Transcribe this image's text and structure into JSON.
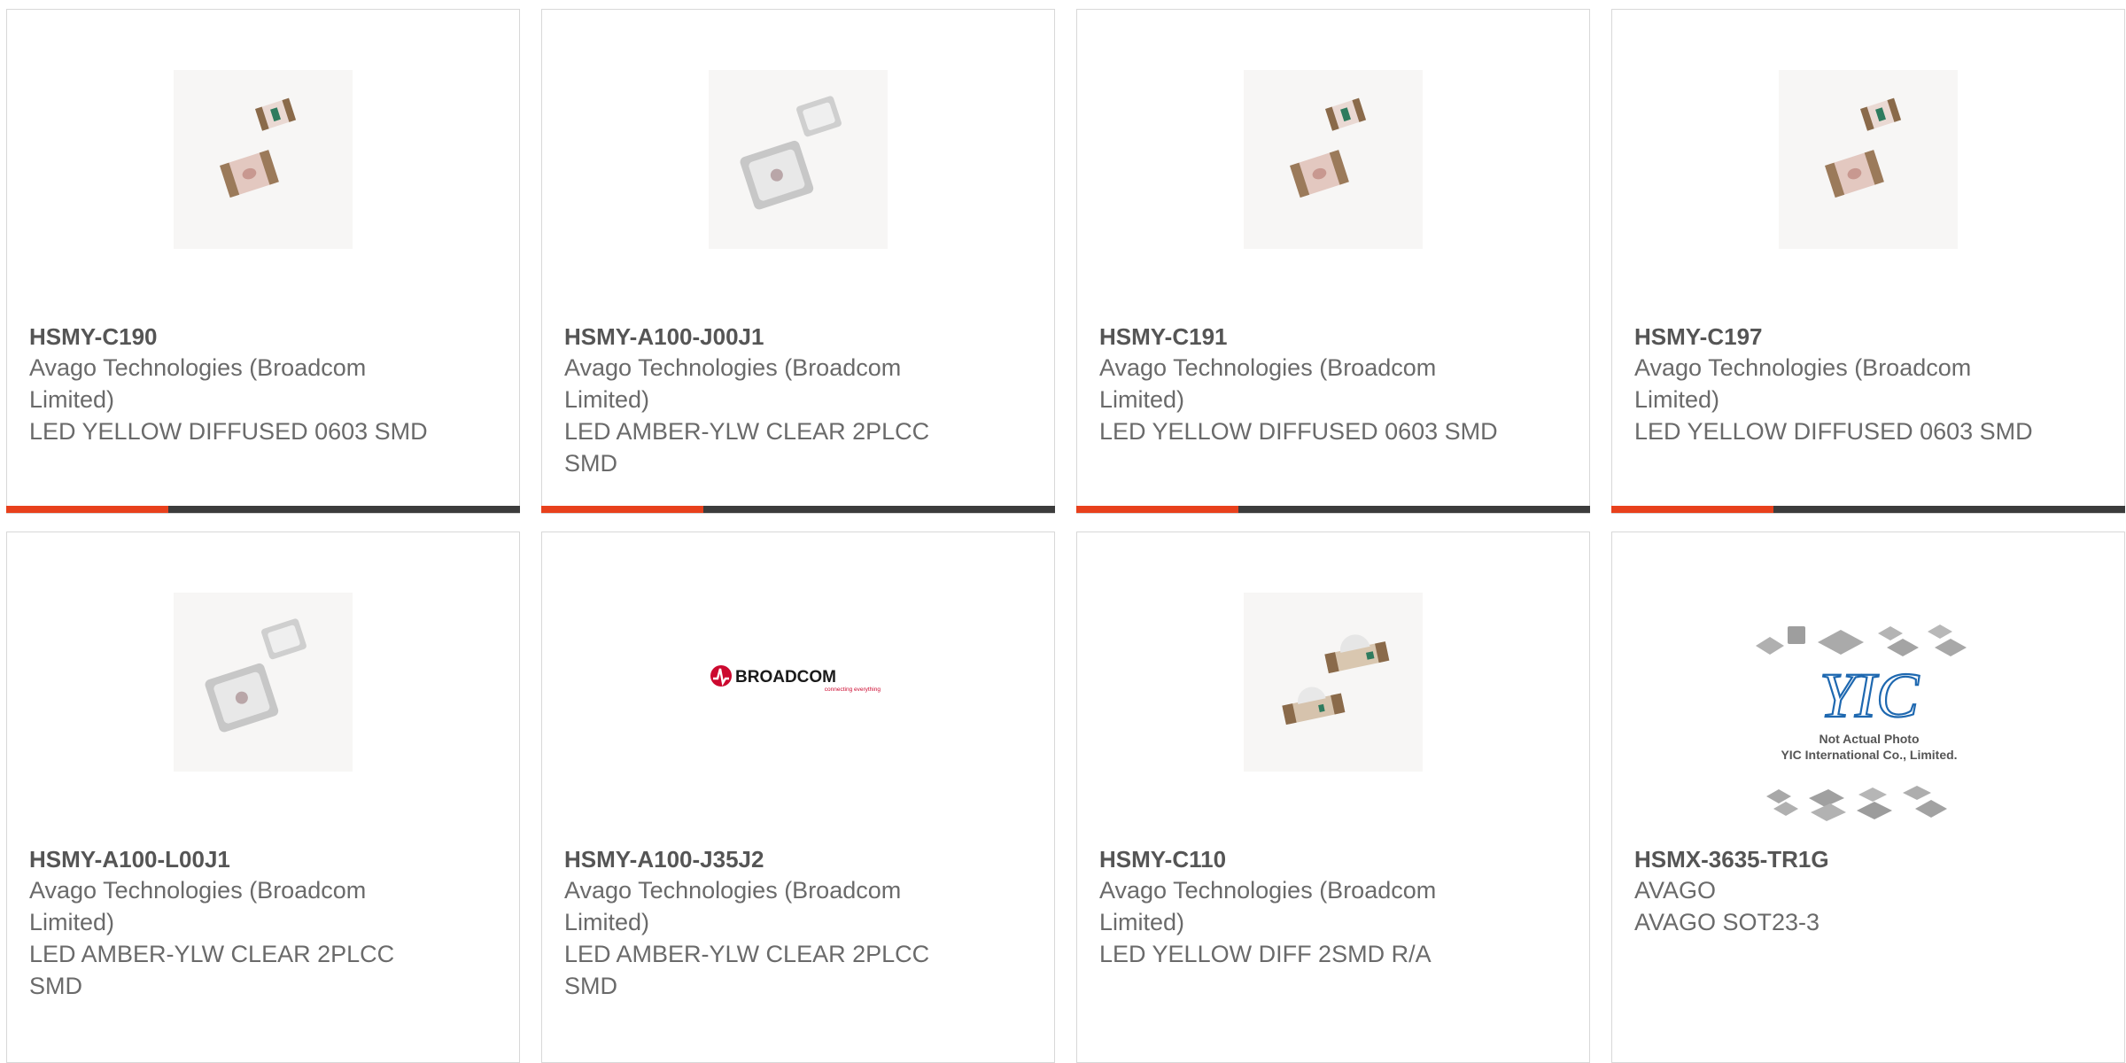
{
  "colors": {
    "accent": "#e8401c",
    "bar": "#3c3c3c",
    "border": "#d8d8d8",
    "broadcom_red": "#cc092f"
  },
  "products": [
    {
      "part_number": "HSMY-C190",
      "manufacturer": "Avago Technologies (Broadcom Limited)",
      "description": "LED YELLOW DIFFUSED 0603 SMD",
      "image": "led-0603-image"
    },
    {
      "part_number": "HSMY-A100-J00J1",
      "manufacturer": "Avago Technologies (Broadcom Limited)",
      "description": "LED AMBER-YLW CLEAR 2PLCC SMD",
      "image": "led-2plcc-image"
    },
    {
      "part_number": "HSMY-C191",
      "manufacturer": "Avago Technologies (Broadcom Limited)",
      "description": "LED YELLOW DIFFUSED 0603 SMD",
      "image": "led-0603-image"
    },
    {
      "part_number": "HSMY-C197",
      "manufacturer": "Avago Technologies (Broadcom Limited)",
      "description": "LED YELLOW DIFFUSED 0603 SMD",
      "image": "led-0603-image"
    },
    {
      "part_number": "HSMY-A100-L00J1",
      "manufacturer": "Avago Technologies (Broadcom Limited)",
      "description": "LED AMBER-YLW CLEAR 2PLCC SMD",
      "image": "led-2plcc-image"
    },
    {
      "part_number": "HSMY-A100-J35J2",
      "manufacturer": "Avago Technologies (Broadcom Limited)",
      "description": "LED AMBER-YLW CLEAR 2PLCC SMD",
      "image": "broadcom-logo"
    },
    {
      "part_number": "HSMY-C110",
      "manufacturer": "Avago Technologies (Broadcom Limited)",
      "description": "LED YELLOW DIFF 2SMD R/A",
      "image": "led-right-angle-image"
    },
    {
      "part_number": "HSMX-3635-TR1G",
      "manufacturer": "AVAGO",
      "description": "AVAGO SOT23-3",
      "image": "yic-placeholder-image"
    }
  ],
  "broadcom_logo": {
    "wordmark": "BROADCOM",
    "tagline": "connecting everything"
  },
  "placeholder": {
    "logo_text": "YIC",
    "line1": "Not Actual Photo",
    "line2": "YIC International Co., Limited."
  }
}
